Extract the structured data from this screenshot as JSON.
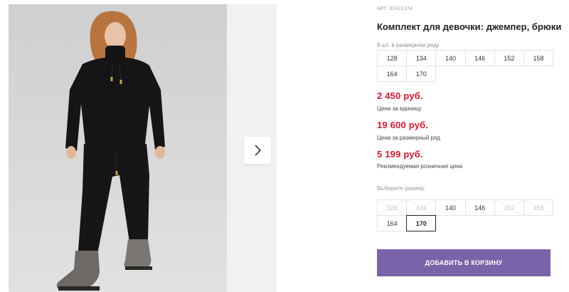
{
  "product": {
    "article": "АРТ. 32421374",
    "title": "Комплект для девочки: джемпер, брюки",
    "pack_label": "8 шт. в размерном ряду",
    "pack_sizes": [
      "128",
      "134",
      "140",
      "146",
      "152",
      "158",
      "164",
      "170"
    ]
  },
  "prices": [
    {
      "value": "2 450 руб.",
      "label": "Цена за единицу"
    },
    {
      "value": "19 600 руб.",
      "label": "Цена за размерный ряд"
    },
    {
      "value": "5 199 руб.",
      "label": "Рекомендуемая розничная цена"
    }
  ],
  "size_select": {
    "label": "Выберите размер:",
    "sizes": [
      {
        "label": "128",
        "available": false,
        "selected": false
      },
      {
        "label": "134",
        "available": false,
        "selected": false
      },
      {
        "label": "140",
        "available": true,
        "selected": false
      },
      {
        "label": "146",
        "available": true,
        "selected": false
      },
      {
        "label": "152",
        "available": false,
        "selected": false
      },
      {
        "label": "158",
        "available": false,
        "selected": false
      },
      {
        "label": "164",
        "available": true,
        "selected": false
      },
      {
        "label": "170",
        "available": true,
        "selected": true
      }
    ]
  },
  "cart_button": {
    "label": "ДОБАВИТЬ В КОРЗИНУ"
  },
  "gallery": {
    "next_icon": "chevron-right-icon"
  },
  "colors": {
    "accent": "#7a63a8",
    "price": "#e0142b",
    "outfit": "#121212"
  }
}
